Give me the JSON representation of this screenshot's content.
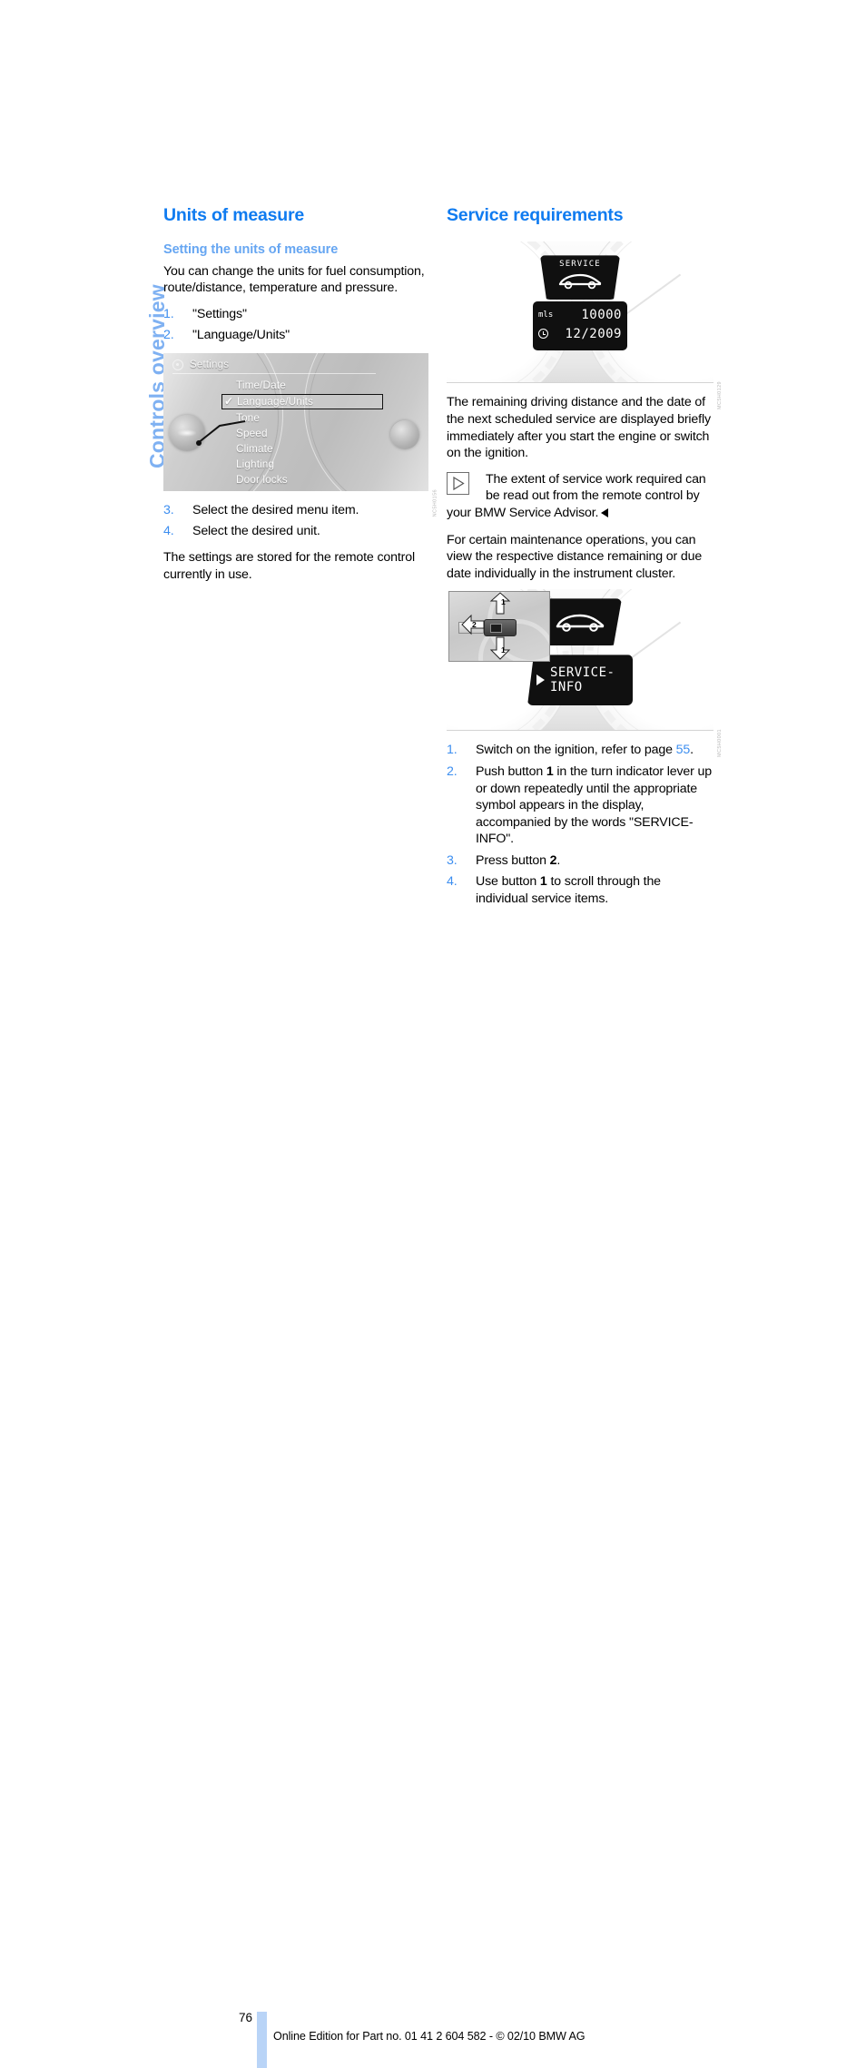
{
  "chapter_tab": {
    "label": "Controls overview"
  },
  "left_column": {
    "section_title": "Units of measure",
    "subsection_title": "Setting the units of measure",
    "intro": "You can change the units for fuel consumption, route/distance, temperature and pressure.",
    "steps_top": [
      {
        "num": "1.",
        "text": "\"Settings\""
      },
      {
        "num": "2.",
        "text": "\"Language/Units\""
      }
    ],
    "figure": {
      "header_label": "Settings",
      "header_icon": "gear-icon",
      "menu_items": [
        {
          "label": "Time/Date",
          "selected": false
        },
        {
          "label": "Language/Units",
          "selected": true
        },
        {
          "label": "Tone",
          "selected": false
        },
        {
          "label": "Speed",
          "selected": false
        },
        {
          "label": "Climate",
          "selected": false
        },
        {
          "label": "Lighting",
          "selected": false
        },
        {
          "label": "Door locks",
          "selected": false
        }
      ],
      "check_mark": "✓",
      "code": "NC5H0156"
    },
    "steps_bottom": [
      {
        "num": "3.",
        "text": "Select the desired menu item."
      },
      {
        "num": "4.",
        "text": "Select the desired unit."
      }
    ],
    "closing": "The settings are stored for the remote control currently in use."
  },
  "right_column": {
    "section_title": "Service requirements",
    "figure_service": {
      "display_word": "SERVICE",
      "car_icon": "car-silhouette-icon",
      "unit_tag": "mls",
      "distance_value": "10000",
      "clock_icon": "clock-icon",
      "date_value": "12/2009",
      "code": "MC5H0129"
    },
    "paragraph_1": "The remaining driving distance and the date of the next scheduled service are displayed briefly immediately after you start the engine or switch on the ignition.",
    "note": {
      "icon": "play-triangle-icon",
      "line1": "The extent of service work required can",
      "line2": "be read out from the remote control by",
      "line3": "your BMW Service Advisor."
    },
    "paragraph_2": "For certain maintenance operations, you can view the respective distance remaining or due date individually in the instrument cluster.",
    "figure_service_info": {
      "car_icon": "car-silhouette-icon",
      "info_line1": "SERVICE-",
      "info_line2": "INFO",
      "inset_labels": {
        "up": "1",
        "down": "1",
        "press": "2"
      },
      "code": "MC5H0001"
    },
    "steps": [
      {
        "num": "1.",
        "pre": "Switch on the ignition, refer to page ",
        "pageref": "55",
        "post": "."
      },
      {
        "num": "2.",
        "segments": "Push button 1 in the turn indicator lever up or down repeatedly until the appropriate symbol appears in the display, accompanied by the words \"SERVICE-INFO\"."
      },
      {
        "num": "3.",
        "segments": "Press button 2."
      },
      {
        "num": "4.",
        "segments": "Use button 1 to scroll through the individual service items."
      }
    ]
  },
  "footer": {
    "page_number": "76",
    "text": "Online Edition for Part no. 01 41 2 604 582 - © 02/10 BMW AG",
    "bar_color": "#B9D4F7"
  },
  "colors": {
    "heading_blue": "#0F7BF0",
    "subheading_blue": "#66A6F2",
    "tab_blue": "#7FB1F2",
    "number_blue": "#3C8EF0"
  }
}
